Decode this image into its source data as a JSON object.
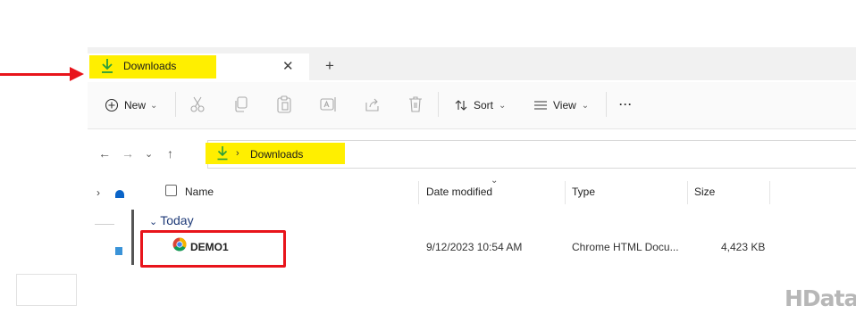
{
  "tab": {
    "title": "Downloads",
    "close": "✕",
    "new": "+"
  },
  "toolbar": {
    "new_label": "New",
    "sort_label": "Sort",
    "view_label": "View",
    "more_label": "···",
    "chevron": "⌄"
  },
  "nav": {
    "back": "←",
    "forward": "→",
    "recent": "⌄",
    "up": "↑"
  },
  "address": {
    "separator": "›",
    "path": "Downloads"
  },
  "navpane": {
    "expand": "›"
  },
  "columns": {
    "name": "Name",
    "date_modified": "Date modified",
    "type": "Type",
    "size": "Size",
    "sort_indicator": "⌄"
  },
  "group": {
    "label": "Today",
    "chevron": "⌄"
  },
  "files": [
    {
      "name": "DEMO1",
      "date_modified": "9/12/2023 10:54 AM",
      "type": "Chrome HTML Docu...",
      "size": "4,423 KB",
      "icon": "chrome-icon"
    }
  ],
  "watermark": "HData",
  "colors": {
    "highlight": "#ffef00",
    "annotation_red": "#e8141b",
    "download_green": "#2a9d3a",
    "group_blue": "#1e3a78"
  }
}
